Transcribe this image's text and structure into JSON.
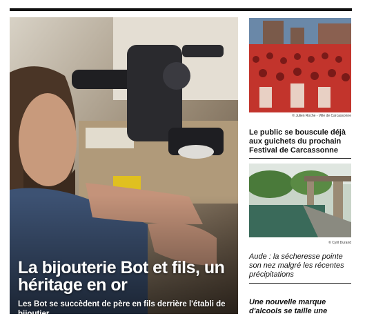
{
  "hero": {
    "title": "La bijouterie Bot et fils, un héritage en or",
    "subtitle": "Les Bot se succèdent de père en fils derrière l'établi de bijoutier..."
  },
  "articles": [
    {
      "credit": "© Julien Roche - Ville de Carcassonne",
      "title": "Le public se bouscule déjà aux guichets du prochain Festival de Carcassonne"
    },
    {
      "credit": "© Cyril Durand",
      "title": "Aude : la sécheresse pointe son nez malgré les récentes précipitations"
    },
    {
      "title": "Une nouvelle marque d'alcools se taille une"
    }
  ]
}
